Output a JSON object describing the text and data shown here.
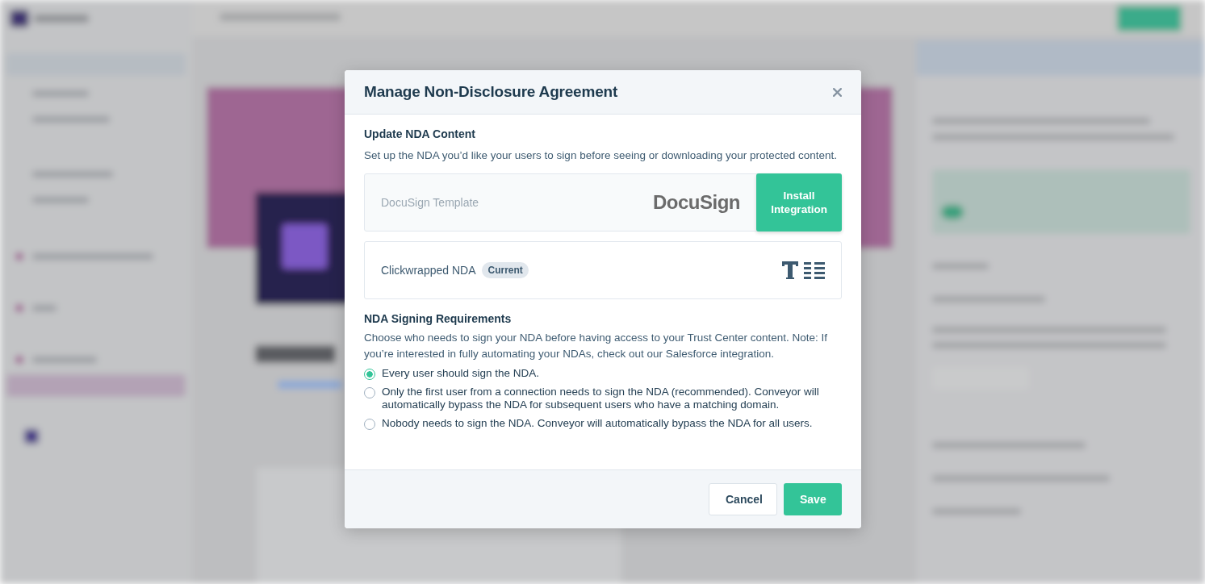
{
  "modal": {
    "title": "Manage Non-Disclosure Agreement",
    "content_section": {
      "heading": "Update NDA Content",
      "description": "Set up the NDA you’d like your users to sign before seeing or downloading your protected content.",
      "options": [
        {
          "kind": "integration",
          "label": "DocuSign Template",
          "logo": "DocuSign",
          "button": "Install Integration"
        },
        {
          "kind": "builtin",
          "label": "Clickwrapped NDA",
          "badge": "Current"
        }
      ]
    },
    "signing_section": {
      "heading": "NDA Signing Requirements",
      "description": "Choose who needs to sign your NDA before having access to your Trust Center content. Note: If you’re interested in fully automating your NDAs, check out our Salesforce integration.",
      "choices": [
        {
          "label": "Every user should sign the NDA.",
          "selected": true
        },
        {
          "label": "Only the first user from a connection needs to sign the NDA (recommended). Conveyor will automatically bypass the NDA for subsequent users who have a matching domain.",
          "selected": false
        },
        {
          "label": "Nobody needs to sign the NDA. Conveyor will automatically bypass the NDA for all users.",
          "selected": false
        }
      ]
    },
    "buttons": [
      {
        "kind": "secondary",
        "label": "Cancel"
      },
      {
        "kind": "primary",
        "label": "Save"
      }
    ]
  }
}
